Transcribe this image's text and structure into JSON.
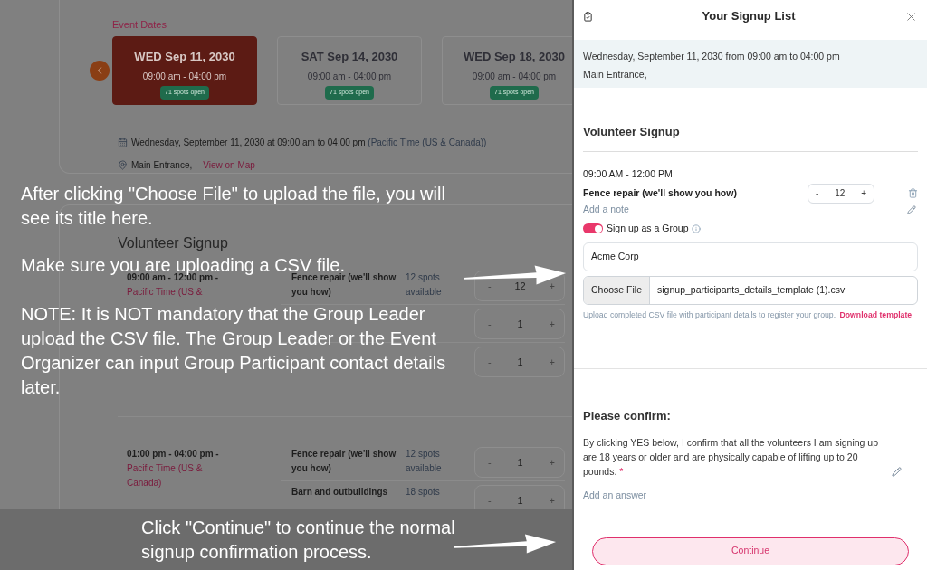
{
  "event_dates": {
    "label": "Event Dates",
    "dates": [
      {
        "day": "WED Sep 11, 2030",
        "time": "09:00 am - 04:00 pm",
        "badge": "71 spots open",
        "selected": true
      },
      {
        "day": "SAT Sep 14, 2030",
        "time": "09:00 am - 04:00 pm",
        "badge": "71 spots open",
        "selected": false
      },
      {
        "day": "WED Sep 18, 2030",
        "time": "09:00 am - 04:00 pm",
        "badge": "71 spots open",
        "selected": false
      }
    ]
  },
  "event_info": {
    "datetime": "Wednesday, September 11, 2030 at 09:00 am to 04:00 pm",
    "timezone": "(Pacific Time (US & Canada))",
    "location": "Main Entrance,",
    "map_link": "View on Map"
  },
  "signup": {
    "title": "Volunteer Signup",
    "slots": [
      {
        "time": "09:00 am - 12:00 pm -",
        "timezone": "Pacific Time (US &",
        "tasks": [
          {
            "name": "Fence repair (we'll show you how)",
            "spots": "12 spots available",
            "decrement": "-",
            "quantity": "12",
            "increment": "+"
          },
          {
            "decrement": "-",
            "quantity": "1",
            "increment": "+"
          },
          {
            "decrement": "-",
            "quantity": "1",
            "increment": "+"
          }
        ]
      },
      {
        "time": "01:00 pm - 04:00 pm -",
        "timezone": "Pacific Time (US & Canada)",
        "tasks": [
          {
            "name": "Fence repair (we'll show you how)",
            "spots": "12 spots available",
            "decrement": "-",
            "quantity": "1",
            "increment": "+"
          },
          {
            "name": "Barn and outbuildings",
            "spots": "18 spots",
            "decrement": "-",
            "quantity": "1",
            "increment": "+"
          }
        ]
      }
    ]
  },
  "overlay_notes": {
    "upload_hint": "After clicking \"Choose File\" to upload the file, you will see its title here.",
    "csv_hint": "Make sure you are uploading a CSV file.",
    "note": "NOTE: It is NOT mandatory that the Group Leader upload the CSV file. The Group Leader or the Event Organizer can input Group Participant contact details later.",
    "continue_hint": "Click \"Continue\" to continue the normal signup confirmation process."
  },
  "panel": {
    "title": "Your Signup List",
    "summary": [
      "Wednesday, September 11, 2030 from 09:00 am to 04:00 pm",
      "Main Entrance,"
    ],
    "section_title": "Volunteer Signup",
    "item": {
      "time": "09:00 AM - 12:00 PM",
      "task": "Fence repair (we'll show you how)",
      "decrement": "-",
      "quantity": "12",
      "increment": "+",
      "note_link": "Add a note"
    },
    "group_toggle": {
      "label": "Sign up as a Group",
      "on": true
    },
    "group_name": "Acme Corp",
    "file": {
      "button": "Choose File",
      "filename": "signup_participants_details_template (1).csv"
    },
    "help": {
      "text": "Upload completed CSV file with participant details to register your group.",
      "link": "Download template"
    },
    "confirm": {
      "title": "Please confirm:",
      "question": "By clicking YES below, I confirm that all the volunteers I am signing up are 18 years or older and are physically capable of lifting up to 20 pounds.",
      "required": "*",
      "answer_link": "Add an answer"
    },
    "continue_button": "Continue"
  }
}
